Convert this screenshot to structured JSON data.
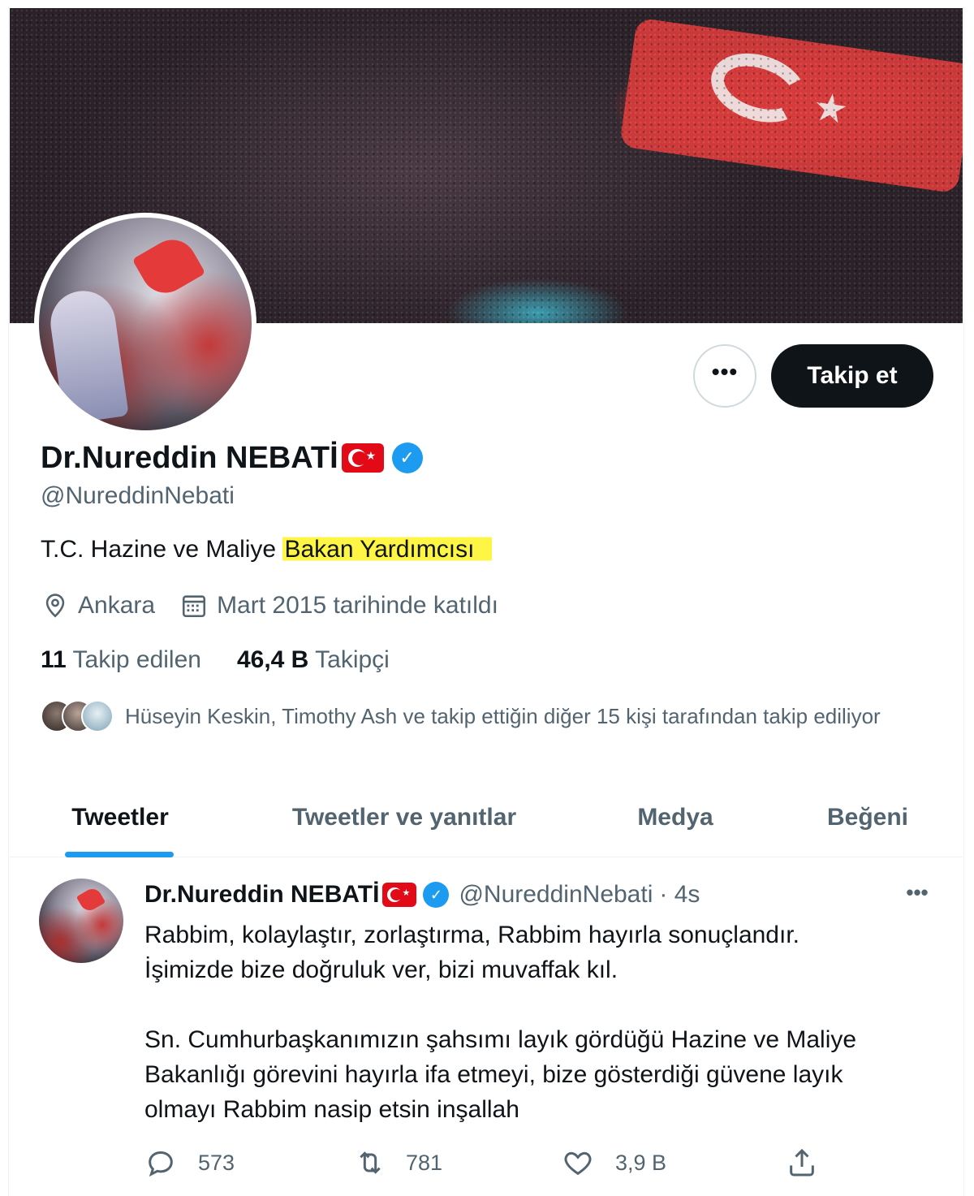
{
  "profile": {
    "display_name": "Dr.Nureddin NEBATİ",
    "handle": "@NureddinNebati",
    "bio_prefix": "T.C. Hazine ve Maliye ",
    "bio_highlight": "Bakan Yardımcısı",
    "location": "Ankara",
    "joined": "Mart 2015 tarihinde katıldı",
    "following_count": "11",
    "following_label": "Takip edilen",
    "followers_count": "46,4 B",
    "followers_label": "Takipçi",
    "followed_by": "Hüseyin Keskin, Timothy Ash ve takip ettiğin diğer 15 kişi tarafından takip ediliyor",
    "follow_button": "Takip et",
    "more_button": "•••"
  },
  "tabs": [
    {
      "label": "Tweetler",
      "active": true
    },
    {
      "label": "Tweetler ve yanıtlar",
      "active": false
    },
    {
      "label": "Medya",
      "active": false
    },
    {
      "label": "Beğeni",
      "active": false
    }
  ],
  "tweet": {
    "name": "Dr.Nureddin NEBATİ",
    "handle": "@NureddinNebati",
    "time": "· 4s",
    "more": "•••",
    "lines": [
      "Rabbim, kolaylaştır, zorlaştırma, Rabbim hayırla sonuçlandır.",
      "İşimizde bize doğruluk ver, bizi muvaffak kıl.",
      "",
      "Sn. Cumhurbaşkanımızın şahsımı layık gördüğü Hazine ve Maliye",
      "Bakanlığı görevini hayırla ifa etmeyi, bize gösterdiği güvene layık",
      "olmayı Rabbim nasip etsin inşallah"
    ],
    "replies": "573",
    "retweets": "781",
    "likes": "3,9 B"
  },
  "icons": {
    "verified": "verified-badge-icon",
    "flag": "turkey-flag-icon",
    "location": "location-pin-icon",
    "calendar": "calendar-icon",
    "reply": "reply-icon",
    "retweet": "retweet-icon",
    "like": "heart-icon",
    "share": "share-icon"
  },
  "colors": {
    "accent": "#1d9bf0",
    "text": "#0f1419",
    "muted": "#536471",
    "highlight": "#fff544",
    "follow_button_bg": "#0f1419"
  }
}
